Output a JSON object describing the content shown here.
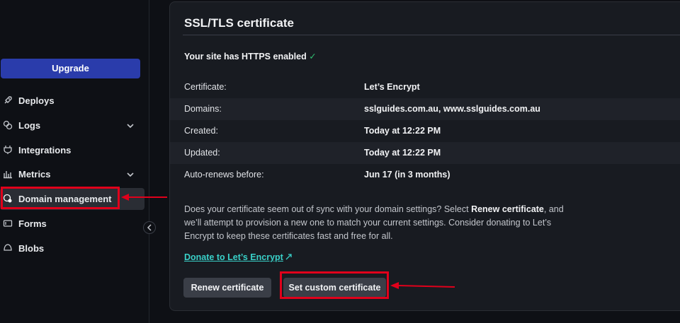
{
  "sidebar": {
    "upgrade_label": "Upgrade",
    "items": [
      {
        "label": "Deploys",
        "icon": "rocket-icon"
      },
      {
        "label": "Logs",
        "icon": "logs-icon"
      },
      {
        "label": "Integrations",
        "icon": "plug-icon"
      },
      {
        "label": "Metrics",
        "icon": "bar-chart-icon"
      },
      {
        "label": "Domain management",
        "icon": "domain-icon"
      },
      {
        "label": "Forms",
        "icon": "forms-icon"
      },
      {
        "label": "Blobs",
        "icon": "blobs-icon"
      }
    ]
  },
  "ssl": {
    "title": "SSL/TLS certificate",
    "https_status": "Your site has HTTPS enabled",
    "check_mark": "✓",
    "details": [
      {
        "label": "Certificate:",
        "value": "Let’s Encrypt"
      },
      {
        "label": "Domains:",
        "value": "sslguides.com.au, www.sslguides.com.au"
      },
      {
        "label": "Created:",
        "value": "Today at 12:22 PM"
      },
      {
        "label": "Updated:",
        "value": "Today at 12:22 PM"
      },
      {
        "label": "Auto-renews before:",
        "value": "Jun 17 (in 3 months)"
      }
    ],
    "description": {
      "part1": "Does your certificate seem out of sync with your domain settings? Select ",
      "bold": "Renew certificate",
      "part2": ", and we’ll attempt to provision a new one to match your current settings. Consider donating to Let’s Encrypt to keep these certificates fast and free for all."
    },
    "donate_link": "Donate to Let’s Encrypt",
    "renew_button": "Renew certificate",
    "custom_button": "Set custom certificate"
  },
  "colors": {
    "accent": "#2a3cab",
    "highlight": "#e0001b",
    "link": "#39d0c8",
    "success": "#2fbf71"
  }
}
